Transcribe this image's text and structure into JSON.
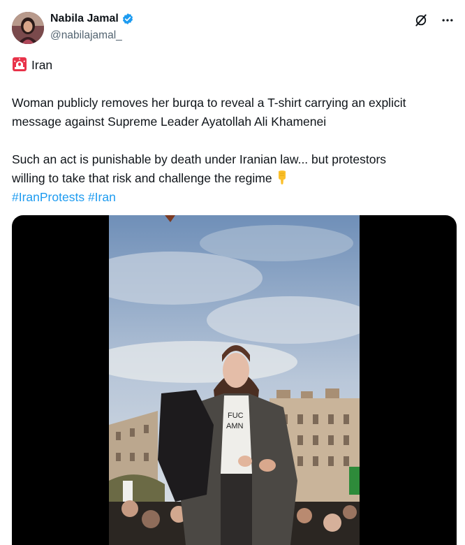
{
  "author": {
    "name": "Nabila Jamal",
    "handle": "@nabilajamal_",
    "verified": true,
    "avatar_icon": "profile-photo"
  },
  "actions": {
    "grok_icon": "grok-icon",
    "more_icon": "more-icon"
  },
  "tweet": {
    "location_emoji": "siren-emoji",
    "location": "Iran",
    "paragraph1_line1": "Woman publicly removes her burqa to reveal a T-shirt carrying an explicit",
    "paragraph1_line2": "message against Supreme Leader Ayatollah Ali Khamenei",
    "paragraph2_line1": "Such an act is punishable by death under Iranian law... but protestors",
    "paragraph2_line2": "willing to take that risk and challenge the regime",
    "pointing_emoji": "pointing-down-emoji",
    "hashtags": [
      "#IranProtests",
      "#Iran"
    ]
  },
  "colors": {
    "text": "#0f1419",
    "secondary": "#536471",
    "link": "#1d9bf0",
    "verified": "#1d9bf0"
  }
}
